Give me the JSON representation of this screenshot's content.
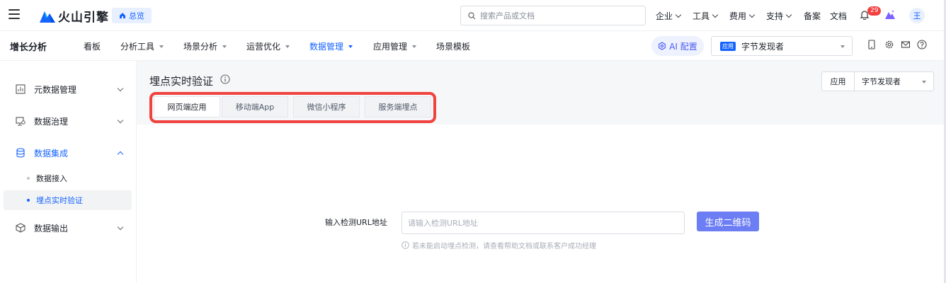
{
  "topbar": {
    "brand": "火山引擎",
    "overview": "总览",
    "search_placeholder": "搜索产品或文档",
    "menus": [
      "企业",
      "工具",
      "费用",
      "支持"
    ],
    "links": [
      "备案",
      "文档"
    ],
    "notification_count": "29",
    "avatar": "王"
  },
  "subnav": {
    "product": "增长分析",
    "items": [
      {
        "label": "看板"
      },
      {
        "label": "分析工具"
      },
      {
        "label": "场景分析"
      },
      {
        "label": "运营优化"
      },
      {
        "label": "数据管理"
      },
      {
        "label": "应用管理"
      },
      {
        "label": "场景模板"
      }
    ],
    "ai_label": "AI 配置",
    "app_tag": "应用",
    "app_name": "字节发现者"
  },
  "sidebar": {
    "items": [
      {
        "label": "元数据管理"
      },
      {
        "label": "数据治理"
      },
      {
        "label": "数据集成"
      },
      {
        "label": "数据输出"
      }
    ],
    "subitems": [
      {
        "label": "数据接入"
      },
      {
        "label": "埋点实时验证"
      }
    ]
  },
  "main": {
    "title": "埋点实时验证",
    "app_filter_label": "应用",
    "app_filter_value": "字节发现者",
    "tabs": [
      {
        "label": "网页端应用"
      },
      {
        "label": "移动端App"
      },
      {
        "label": "微信小程序"
      },
      {
        "label": "服务端埋点"
      }
    ],
    "url_label": "输入检测URL地址",
    "url_placeholder": "请输入检测URL地址",
    "generate_button": "生成二维码",
    "hint": "若未能启动埋点检测，请查看帮助文档或联系客户成功经理"
  },
  "colors": {
    "accent": "#1664ff",
    "highlight_border": "#f0433f",
    "button": "#6d7ef5"
  }
}
